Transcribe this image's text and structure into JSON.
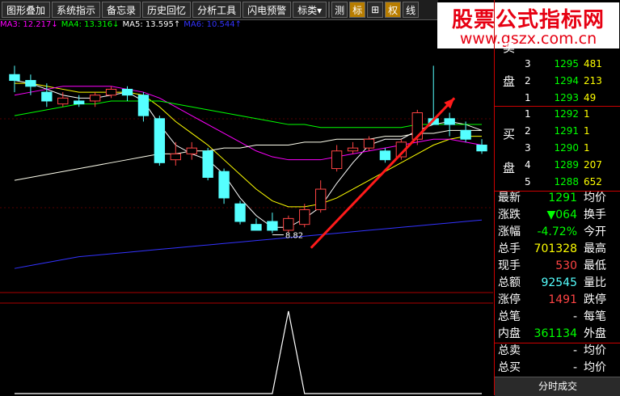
{
  "toolbar": {
    "buttons": [
      "图形叠加",
      "系统指示",
      "备忘录",
      "历史回忆",
      "分析工具",
      "闪电预警",
      "标类▾"
    ],
    "icons": [
      {
        "label": "测",
        "name": "measure-icon",
        "active": false
      },
      {
        "label": "标",
        "name": "mark-icon",
        "active": true
      },
      {
        "label": "⊞",
        "name": "grid-icon",
        "active": false
      },
      {
        "label": "权",
        "name": "rights-icon",
        "active": true
      },
      {
        "label": "线",
        "name": "line-icon",
        "active": false
      }
    ]
  },
  "ma_bar": [
    {
      "label": "MA3: 12.217↓",
      "color": "#ff00ff"
    },
    {
      "label": "MA4: 13.316↓",
      "color": "#00ff00"
    },
    {
      "label": "MA5: 13.595↑",
      "color": "#ffffff"
    },
    {
      "label": "MA6: 10.544↑",
      "color": "#3333ff"
    }
  ],
  "brand": {
    "title": "股票公式指标网",
    "url": "www.gszx.com.cn"
  },
  "chart_data": {
    "type": "candlestick",
    "colors": {
      "up": "#ff4444",
      "down": "#55ffff"
    },
    "low_annotation": "8.82",
    "candles": [
      {
        "o": 14.2,
        "h": 14.5,
        "l": 13.6,
        "c": 14.0
      },
      {
        "o": 14.0,
        "h": 14.2,
        "l": 13.5,
        "c": 13.8
      },
      {
        "o": 13.6,
        "h": 13.9,
        "l": 13.1,
        "c": 13.3
      },
      {
        "o": 13.2,
        "h": 13.6,
        "l": 13.1,
        "c": 13.4
      },
      {
        "o": 13.3,
        "h": 13.5,
        "l": 13.1,
        "c": 13.2
      },
      {
        "o": 13.3,
        "h": 13.6,
        "l": 13.1,
        "c": 13.5
      },
      {
        "o": 13.5,
        "h": 13.8,
        "l": 13.4,
        "c": 13.7
      },
      {
        "o": 13.7,
        "h": 13.8,
        "l": 13.3,
        "c": 13.5
      },
      {
        "o": 13.5,
        "h": 13.6,
        "l": 12.6,
        "c": 12.8
      },
      {
        "o": 12.7,
        "h": 12.8,
        "l": 11.1,
        "c": 11.2
      },
      {
        "o": 11.3,
        "h": 11.9,
        "l": 11.1,
        "c": 11.5
      },
      {
        "o": 11.5,
        "h": 11.9,
        "l": 11.3,
        "c": 11.7
      },
      {
        "o": 11.6,
        "h": 11.7,
        "l": 10.6,
        "c": 10.7
      },
      {
        "o": 10.9,
        "h": 11.0,
        "l": 9.8,
        "c": 10.0
      },
      {
        "o": 9.8,
        "h": 9.9,
        "l": 9.1,
        "c": 9.2
      },
      {
        "o": 9.1,
        "h": 9.3,
        "l": 8.9,
        "c": 8.9
      },
      {
        "o": 9.2,
        "h": 9.5,
        "l": 8.8,
        "c": 8.9
      },
      {
        "o": 8.9,
        "h": 9.4,
        "l": 8.82,
        "c": 9.3
      },
      {
        "o": 9.1,
        "h": 9.8,
        "l": 9.0,
        "c": 9.6
      },
      {
        "o": 9.6,
        "h": 10.6,
        "l": 9.5,
        "c": 10.3
      },
      {
        "o": 11.0,
        "h": 11.8,
        "l": 10.9,
        "c": 11.6
      },
      {
        "o": 11.6,
        "h": 11.9,
        "l": 11.5,
        "c": 11.7
      },
      {
        "o": 11.7,
        "h": 12.1,
        "l": 11.6,
        "c": 12.0
      },
      {
        "o": 11.6,
        "h": 11.7,
        "l": 11.2,
        "c": 11.3
      },
      {
        "o": 11.4,
        "h": 12.0,
        "l": 11.3,
        "c": 11.9
      },
      {
        "o": 12.0,
        "h": 13.0,
        "l": 11.8,
        "c": 12.9
      },
      {
        "o": 12.7,
        "h": 14.5,
        "l": 12.6,
        "c": 12.5
      },
      {
        "o": 12.7,
        "h": 12.9,
        "l": 12.1,
        "c": 12.5
      },
      {
        "o": 12.3,
        "h": 12.6,
        "l": 11.9,
        "c": 12.0
      },
      {
        "o": 11.8,
        "h": 12.0,
        "l": 11.5,
        "c": 11.6
      }
    ],
    "ma_lines": [
      {
        "name": "MA3",
        "color": "#ffffff",
        "values": [
          14.0,
          13.9,
          13.7,
          13.5,
          13.4,
          13.4,
          13.5,
          13.6,
          13.3,
          12.5,
          11.8,
          11.5,
          11.3,
          10.8,
          10.0,
          9.4,
          9.0,
          9.0,
          9.3,
          9.7,
          10.5,
          11.2,
          11.8,
          12.0,
          12.0,
          12.3,
          12.5,
          12.6,
          12.5,
          12.3
        ]
      },
      {
        "name": "MA4",
        "color": "#ffff00",
        "values": [
          13.9,
          13.9,
          13.8,
          13.7,
          13.6,
          13.6,
          13.6,
          13.6,
          13.5,
          13.1,
          12.6,
          12.2,
          11.8,
          11.3,
          10.8,
          10.3,
          9.9,
          9.7,
          9.7,
          9.8,
          10.0,
          10.3,
          10.6,
          10.9,
          11.2,
          11.5,
          11.8,
          12.0,
          12.1,
          12.1
        ]
      },
      {
        "name": "MA5",
        "color": "#ff00ff",
        "values": [
          13.5,
          13.6,
          13.7,
          13.8,
          13.8,
          13.8,
          13.8,
          13.7,
          13.6,
          13.4,
          13.1,
          12.8,
          12.5,
          12.2,
          11.9,
          11.6,
          11.4,
          11.3,
          11.3,
          11.3,
          11.4,
          11.5,
          11.6,
          11.7,
          11.8,
          11.9,
          12.0,
          12.0,
          11.9,
          11.8
        ]
      },
      {
        "name": "MA6",
        "color": "#00ff00",
        "values": [
          12.8,
          12.9,
          13.0,
          13.1,
          13.2,
          13.2,
          13.3,
          13.3,
          13.3,
          13.3,
          13.2,
          13.1,
          13.0,
          12.9,
          12.8,
          12.7,
          12.6,
          12.5,
          12.5,
          12.4,
          12.4,
          12.4,
          12.4,
          12.4,
          12.4,
          12.5,
          12.5,
          12.5,
          12.5,
          12.5
        ]
      },
      {
        "name": "MA7",
        "color": "#ffffee",
        "values": [
          10.6,
          10.7,
          10.8,
          10.9,
          11.0,
          11.1,
          11.2,
          11.3,
          11.4,
          11.5,
          11.5,
          11.6,
          11.6,
          11.7,
          11.7,
          11.8,
          11.8,
          11.8,
          11.9,
          11.9,
          12.0,
          12.0,
          12.0,
          12.1,
          12.1,
          12.2,
          12.2,
          12.3,
          12.3,
          12.3
        ]
      },
      {
        "name": "MA8",
        "color": "#3333ff",
        "values": [
          7.6,
          7.7,
          7.8,
          7.9,
          8.0,
          8.05,
          8.1,
          8.15,
          8.2,
          8.25,
          8.3,
          8.35,
          8.4,
          8.45,
          8.5,
          8.55,
          8.6,
          8.65,
          8.7,
          8.75,
          8.8,
          8.85,
          8.9,
          8.95,
          9.0,
          9.05,
          9.1,
          9.15,
          9.2,
          9.25
        ]
      }
    ],
    "ylim": [
      7.0,
      15.5
    ],
    "lower_panel": {
      "values": [
        0,
        0,
        0,
        0,
        0,
        0,
        0,
        0,
        0,
        0,
        0,
        0,
        0,
        0,
        0,
        0,
        0,
        1,
        0,
        0,
        0,
        0,
        0,
        0,
        0,
        0,
        0,
        0,
        0,
        0
      ]
    }
  },
  "order_book": {
    "sell_label": "卖",
    "pan_label": "盘",
    "buy_label": "买",
    "sell": [
      {
        "level": "3",
        "price": "1295",
        "vol": "481"
      },
      {
        "level": "2",
        "price": "1294",
        "vol": "213"
      },
      {
        "level": "1",
        "price": "1293",
        "vol": "49"
      }
    ],
    "buy": [
      {
        "level": "1",
        "price": "1292",
        "vol": "1"
      },
      {
        "level": "2",
        "price": "1291",
        "vol": "1"
      },
      {
        "level": "3",
        "price": "1290",
        "vol": "1"
      },
      {
        "level": "4",
        "price": "1289",
        "vol": "207"
      },
      {
        "level": "5",
        "price": "1288",
        "vol": "652"
      }
    ]
  },
  "quotes": [
    {
      "k": "最新",
      "v": "1291",
      "vc": "#00ff00",
      "k2": "均价"
    },
    {
      "k": "涨跌",
      "v": "▼064",
      "vc": "#00ff00",
      "k2": "换手"
    },
    {
      "k": "涨幅",
      "v": "-4.72%",
      "vc": "#00ff00",
      "k2": "今开"
    },
    {
      "k": "总手",
      "v": "701328",
      "vc": "#ffff00",
      "k2": "最高"
    },
    {
      "k": "现手",
      "v": "530",
      "vc": "#ff4444",
      "k2": "最低"
    },
    {
      "k": "总额",
      "v": "92545",
      "vc": "#55ffff",
      "k2": "量比"
    },
    {
      "k": "涨停",
      "v": "1491",
      "vc": "#ff4444",
      "k2": "跌停"
    },
    {
      "k": "总笔",
      "v": "-",
      "vc": "#ffffff",
      "k2": "每笔"
    },
    {
      "k": "内盘",
      "v": "361134",
      "vc": "#00ff00",
      "k2": "外盘"
    },
    {
      "k": "总卖",
      "v": "-",
      "vc": "#ffffff",
      "k2": "均价"
    },
    {
      "k": "总买",
      "v": "-",
      "vc": "#ffffff",
      "k2": "均价"
    }
  ],
  "footer": {
    "label": "分时成交"
  }
}
